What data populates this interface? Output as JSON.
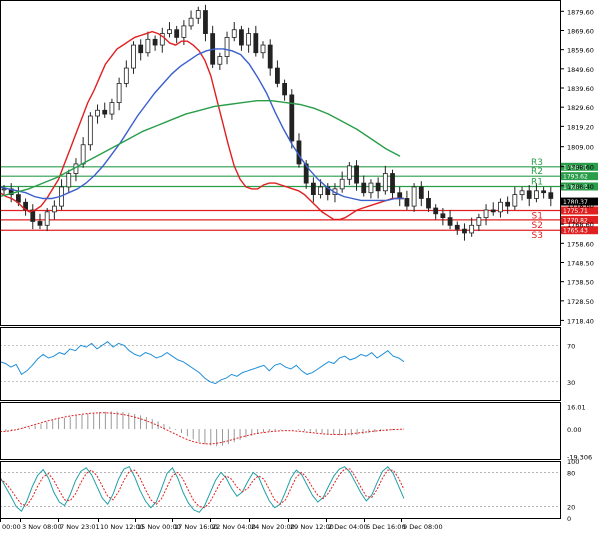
{
  "chart_data": [
    {
      "type": "candlestick",
      "panel": "price",
      "y_ticks": [
        1879.6,
        1869.6,
        1859.6,
        1849.6,
        1839.6,
        1829.6,
        1819.6,
        1809.0,
        1798.6,
        1788.6,
        1778.6,
        1768.6,
        1758.6,
        1748.6,
        1738.6,
        1728.6,
        1718.4
      ],
      "y_tick_labels": [
        "1879.60",
        "1869.60",
        "1859.60",
        "1849.60",
        "1839.60",
        "1829.60",
        "1819.20",
        "1809.00",
        "1798.60",
        "1788.40",
        "1778.60",
        "1768.60",
        "1758.60",
        "1748.50",
        "1738.50",
        "1728.50",
        "1718.40"
      ],
      "ylim": [
        1716.0,
        1885.5
      ],
      "x_tick_labels": [
        "00:00",
        "3 Nov 08:00",
        "7 Nov 23:01",
        "10 Nov 12:00",
        "15 Nov 00:00",
        "17 Nov 16:00",
        "22 Nov 04:00",
        "24 Nov 20:00",
        "29 Nov 12:00",
        "2 Dec 04:00",
        "6 Dec 16:00",
        "9 Dec 08:00"
      ],
      "close_path": [
        1787,
        1784,
        1780,
        1776,
        1770,
        1768,
        1775,
        1778,
        1788,
        1795,
        1800,
        1810,
        1825,
        1828,
        1826,
        1832,
        1842,
        1850,
        1862,
        1858,
        1865,
        1862,
        1868,
        1870,
        1866,
        1872,
        1876,
        1880,
        1868,
        1852,
        1856,
        1866,
        1870,
        1862,
        1868,
        1858,
        1862,
        1850,
        1842,
        1836,
        1812,
        1800,
        1790,
        1784,
        1788,
        1784,
        1787,
        1792,
        1799,
        1790,
        1785,
        1790,
        1786,
        1795,
        1785,
        1782,
        1778,
        1788,
        1782,
        1777,
        1774,
        1772,
        1768,
        1766,
        1764,
        1768,
        1772,
        1776,
        1775,
        1780,
        1778,
        1784,
        1786,
        1782,
        1786,
        1785,
        1782
      ],
      "close_last": 1780.37,
      "close_label": "1780.37",
      "series": [
        {
          "name": "",
          "color": "#e02020",
          "values": [
            1785,
            1783,
            1782,
            1780,
            1777,
            1775,
            1776,
            1778,
            1782,
            1787,
            1792,
            1800,
            1808,
            1816,
            1824,
            1832,
            1838,
            1845,
            1852,
            1856,
            1860,
            1862,
            1864,
            1866,
            1867,
            1868,
            1869,
            1868,
            1866,
            1863,
            1862,
            1864,
            1864,
            1862,
            1859,
            1854,
            1846,
            1834,
            1822,
            1810,
            1799,
            1792,
            1788,
            1787,
            1787,
            1789,
            1790,
            1790,
            1789,
            1788,
            1787,
            1786,
            1784,
            1781,
            1778,
            1775,
            1773,
            1771,
            1771,
            1772,
            1774,
            1776,
            1777,
            1778,
            1779,
            1780,
            1781,
            1782,
            1782,
            1782
          ]
        },
        {
          "name": "",
          "color": "#3a5fcd",
          "values": [
            1788,
            1787,
            1786,
            1785,
            1783,
            1782,
            1782,
            1783,
            1785,
            1787,
            1790,
            1794,
            1799,
            1805,
            1811,
            1818,
            1825,
            1831,
            1837,
            1842,
            1847,
            1851,
            1854,
            1857,
            1859,
            1860,
            1860,
            1859,
            1857,
            1852,
            1845,
            1837,
            1827,
            1818,
            1810,
            1803,
            1797,
            1792,
            1788,
            1785,
            1783,
            1782,
            1781,
            1781,
            1781,
            1781,
            1782,
            1782
          ]
        },
        {
          "name": "",
          "color": "#2a9d4a",
          "values": [
            1783,
            1785,
            1787,
            1790,
            1793,
            1797,
            1801,
            1805,
            1809,
            1813,
            1817,
            1820,
            1823,
            1826,
            1828,
            1830,
            1831,
            1832,
            1833,
            1833,
            1832,
            1831,
            1829,
            1826,
            1822,
            1818,
            1813,
            1808,
            1804
          ]
        }
      ],
      "levels": [
        {
          "label": "R3",
          "value": 1798.51,
          "value_label": "1798.51",
          "color": "#2a9d4a"
        },
        {
          "label": "R2",
          "value": 1793.62,
          "value_label": "1793.62",
          "color": "#2a9d4a"
        },
        {
          "label": "R1",
          "value": 1788.23,
          "value_label": "1788.23",
          "color": "#2a9d4a"
        },
        {
          "label": "S1",
          "value": 1775.71,
          "value_label": "1775.71",
          "color": "#e02020"
        },
        {
          "label": "S2",
          "value": 1770.82,
          "value_label": "1770.82",
          "color": "#e02020"
        },
        {
          "label": "S3",
          "value": 1765.43,
          "value_label": "1765.43",
          "color": "#e02020"
        }
      ]
    },
    {
      "type": "line",
      "panel": "oscillator-1",
      "ylim": [
        10,
        90
      ],
      "y_ticks": [
        70,
        30
      ],
      "y_tick_labels": [
        "70",
        "30"
      ],
      "series": [
        {
          "name": "",
          "color": "#1f8fd8",
          "values": [
            52,
            50,
            46,
            49,
            38,
            42,
            48,
            55,
            60,
            56,
            58,
            62,
            60,
            66,
            64,
            70,
            68,
            72,
            66,
            70,
            74,
            68,
            72,
            70,
            64,
            60,
            58,
            62,
            60,
            56,
            58,
            62,
            58,
            54,
            52,
            48,
            44,
            40,
            34,
            30,
            28,
            32,
            34,
            38,
            36,
            40,
            42,
            44,
            46,
            48,
            42,
            48,
            50,
            46,
            44,
            48,
            42,
            38,
            40,
            44,
            48,
            52,
            50,
            56,
            58,
            54,
            56,
            60,
            58,
            62,
            56,
            60,
            64,
            58,
            56,
            52
          ]
        }
      ]
    },
    {
      "type": "bar",
      "panel": "oscillator-2",
      "ylim": [
        -21,
        19
      ],
      "y_ticks": [
        16.01,
        0.0,
        -19.306
      ],
      "y_tick_labels": [
        "16.01",
        "0.00",
        "-19.306"
      ],
      "values": [
        -1.0,
        -1.5,
        -1.2,
        -0.6,
        0.3,
        1.2,
        2.5,
        3.8,
        5.0,
        6.2,
        7.0,
        7.8,
        8.5,
        9.2,
        10.0,
        10.8,
        11.4,
        11.9,
        12.2,
        12.4,
        12.3,
        12.0,
        11.4,
        10.6,
        9.6,
        8.4,
        7.0,
        5.4,
        3.6,
        1.6,
        -0.6,
        -2.8,
        -5.0,
        -7.2,
        -9.0,
        -10.6,
        -11.6,
        -12.0,
        -11.6,
        -10.6,
        -9.2,
        -7.6,
        -6.0,
        -4.6,
        -3.4,
        -2.4,
        -1.6,
        -1.0,
        -0.4,
        0.0,
        -0.2,
        -0.6,
        -1.2,
        -1.8,
        -2.4,
        -3.0,
        -3.6,
        -4.0,
        -4.4,
        -4.6,
        -4.4,
        -4.0,
        -3.4,
        -2.8,
        -2.2,
        -1.6,
        -1.2,
        -0.8,
        -0.4,
        -0.1
      ],
      "signal": [
        -1.8,
        -1.6,
        -1.0,
        -0.2,
        0.8,
        2.0,
        3.2,
        4.4,
        5.6,
        6.6,
        7.6,
        8.4,
        9.2,
        9.8,
        10.4,
        10.9,
        11.2,
        11.4,
        11.4,
        11.2,
        10.8,
        10.2,
        9.4,
        8.4,
        7.2,
        5.8,
        4.2,
        2.4,
        0.4,
        -1.6,
        -3.6,
        -5.6,
        -7.4,
        -8.8,
        -9.8,
        -10.4,
        -10.4,
        -10.0,
        -9.2,
        -8.2,
        -7.0,
        -5.8,
        -4.8,
        -3.8,
        -3.0,
        -2.4,
        -1.9,
        -1.5,
        -1.2,
        -1.1,
        -1.2,
        -1.5,
        -1.9,
        -2.4,
        -2.9,
        -3.3,
        -3.6,
        -3.8,
        -3.8,
        -3.6,
        -3.3,
        -2.8,
        -2.3,
        -1.8,
        -1.4,
        -1.0,
        -0.7,
        -0.4,
        -0.2,
        0.0
      ]
    },
    {
      "type": "line",
      "panel": "oscillator-3",
      "ylim": [
        0,
        100
      ],
      "y_ticks": [
        100,
        80,
        20,
        0
      ],
      "y_tick_labels": [
        "100",
        "80",
        "20",
        "0"
      ],
      "series": [
        {
          "name": "",
          "color": "#1fa0a8",
          "values": [
            72,
            55,
            38,
            20,
            12,
            30,
            55,
            75,
            85,
            70,
            45,
            28,
            22,
            40,
            65,
            82,
            88,
            76,
            55,
            35,
            24,
            42,
            68,
            86,
            90,
            72,
            48,
            30,
            18,
            28,
            52,
            78,
            88,
            70,
            45,
            26,
            14,
            10,
            22,
            44,
            66,
            80,
            70,
            52,
            38,
            46,
            64,
            80,
            72,
            50,
            30,
            18,
            24,
            46,
            70,
            84,
            76,
            58,
            40,
            28,
            36,
            56,
            74,
            86,
            90,
            80,
            62,
            44,
            30,
            40,
            62,
            82,
            90,
            78,
            56,
            34
          ]
        },
        {
          "name": "",
          "color": "#e02020",
          "values": [
            68,
            62,
            50,
            36,
            24,
            22,
            36,
            56,
            72,
            78,
            66,
            48,
            32,
            30,
            42,
            62,
            78,
            84,
            74,
            56,
            38,
            32,
            46,
            66,
            82,
            84,
            70,
            50,
            32,
            24,
            34,
            54,
            74,
            80,
            68,
            48,
            30,
            20,
            18,
            28,
            46,
            64,
            74,
            68,
            54,
            46,
            52,
            66,
            74,
            68,
            50,
            32,
            24,
            32,
            52,
            72,
            80,
            70,
            54,
            40,
            34,
            44,
            60,
            76,
            86,
            86,
            72,
            54,
            38,
            36,
            50,
            70,
            84,
            84,
            70,
            50
          ]
        }
      ]
    }
  ]
}
